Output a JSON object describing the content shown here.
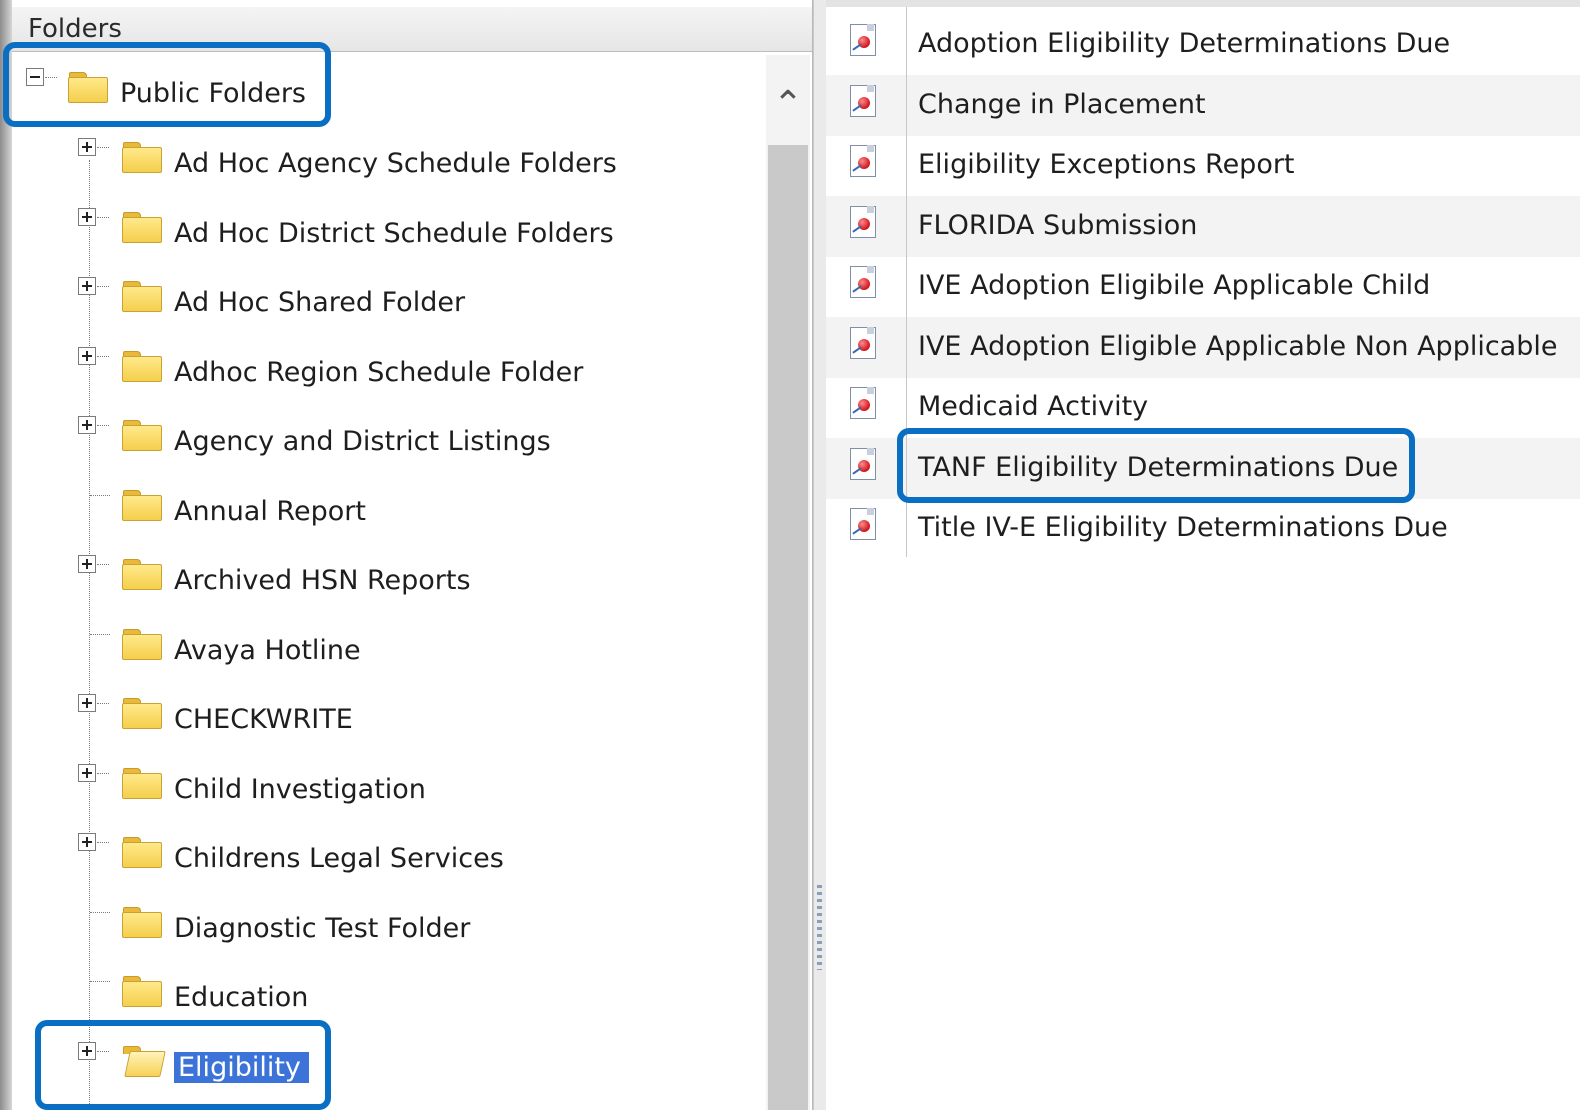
{
  "folders_panel": {
    "header": "Folders",
    "root": {
      "label": "Public Folders"
    },
    "items": [
      {
        "label": "Ad Hoc Agency Schedule Folders",
        "expandable": true
      },
      {
        "label": "Ad Hoc District Schedule Folders",
        "expandable": true
      },
      {
        "label": "Ad Hoc Shared Folder",
        "expandable": true
      },
      {
        "label": "Adhoc Region Schedule Folder",
        "expandable": true
      },
      {
        "label": "Agency and District Listings",
        "expandable": true
      },
      {
        "label": "Annual Report",
        "expandable": false
      },
      {
        "label": "Archived HSN Reports",
        "expandable": true
      },
      {
        "label": "Avaya Hotline",
        "expandable": false
      },
      {
        "label": "CHECKWRITE",
        "expandable": true
      },
      {
        "label": "Child Investigation",
        "expandable": true
      },
      {
        "label": "Childrens Legal Services",
        "expandable": true
      },
      {
        "label": "Diagnostic Test Folder",
        "expandable": false
      },
      {
        "label": "Education",
        "expandable": false
      },
      {
        "label": "Eligibility",
        "expandable": true,
        "selected": true
      }
    ]
  },
  "reports_panel": {
    "items": [
      {
        "label": "Adoption Eligibility Determinations Due"
      },
      {
        "label": "Change in Placement"
      },
      {
        "label": "Eligibility Exceptions Report"
      },
      {
        "label": "FLORIDA Submission"
      },
      {
        "label": "IVE Adoption Eligibile Applicable Child"
      },
      {
        "label": "IVE Adoption Eligible Applicable Non Applicable"
      },
      {
        "label": "Medicaid Activity"
      },
      {
        "label": "TANF Eligibility Determinations Due"
      },
      {
        "label": "Title IV-E Eligibility Determinations Due"
      }
    ]
  },
  "colors": {
    "highlight_border": "#0a6ec2",
    "selection": "#3b73d8",
    "folder": "#f5cf4c"
  }
}
